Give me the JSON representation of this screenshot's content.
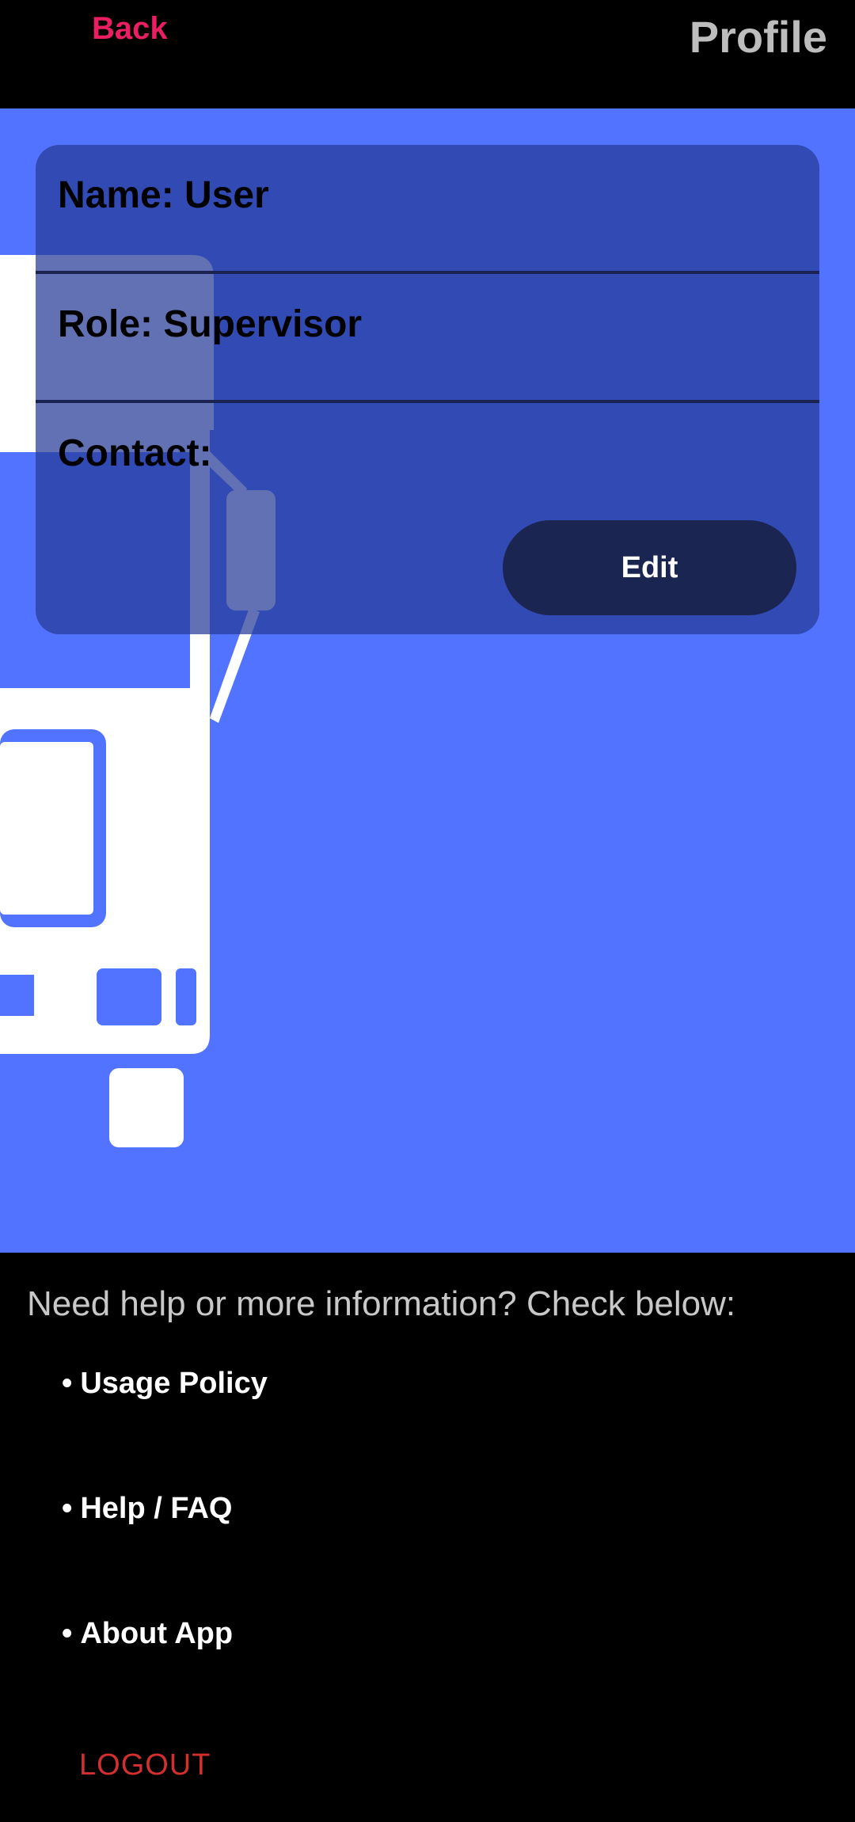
{
  "header": {
    "back_label": "Back",
    "title": "Profile"
  },
  "profile": {
    "name_line": "Name: User",
    "role_line": "Role: Supervisor",
    "contact_line": "Contact:",
    "edit_label": "Edit"
  },
  "help": {
    "intro": "Need help or more information? Check below:",
    "bullet": "•",
    "links": [
      {
        "label": "Usage Policy"
      },
      {
        "label": "Help / FAQ"
      },
      {
        "label": "About App"
      }
    ]
  },
  "logout_label": "LOGOUT",
  "colors": {
    "accent_pink": "#E91E63",
    "hero_blue": "#5273FF",
    "logout_red": "#D32F2F",
    "edit_button_bg": "#1B2552"
  },
  "illustration": {
    "icon": "bus-icon"
  }
}
